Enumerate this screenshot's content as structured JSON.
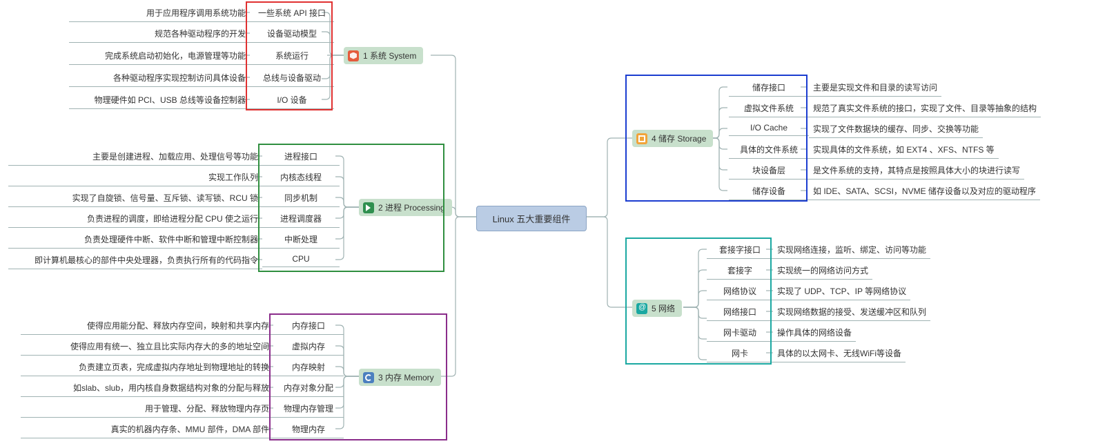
{
  "root": {
    "title": "Linux 五大重要组件"
  },
  "sections": {
    "system": {
      "label": "1 系统 System",
      "icon": "sys"
    },
    "process": {
      "label": "2 进程 Processing",
      "icon": "proc"
    },
    "memory": {
      "label": "3 内存 Memory",
      "icon": "mem"
    },
    "storage": {
      "label": "4 储存 Storage",
      "icon": "stor"
    },
    "network": {
      "label": "5 网络",
      "icon": "net"
    }
  },
  "frame_colors": {
    "system": "#e03030",
    "process": "#2f8f3f",
    "memory": "#8a2c8a",
    "storage": "#1a3cd0",
    "network": "#1aa8a1"
  },
  "system_items": [
    {
      "label": "一些系统 API 接口",
      "desc": "用于应用程序调用系统功能"
    },
    {
      "label": "设备驱动模型",
      "desc": "规范各种驱动程序的开发"
    },
    {
      "label": "系统运行",
      "desc": "完成系统启动初始化，电源管理等功能"
    },
    {
      "label": "总线与设备驱动",
      "desc": "各种驱动程序实现控制访问具体设备"
    },
    {
      "label": "I/O 设备",
      "desc": "物理硬件如 PCI、USB 总线等设备控制器"
    }
  ],
  "process_items": [
    {
      "label": "进程接口",
      "desc": "主要是创建进程、加载应用、处理信号等功能"
    },
    {
      "label": "内核态线程",
      "desc": "实现工作队列"
    },
    {
      "label": "同步机制",
      "desc": "实现了自旋锁、信号量、互斥锁、读写锁、RCU 锁"
    },
    {
      "label": "进程调度器",
      "desc": "负责进程的调度，即给进程分配 CPU 使之运行"
    },
    {
      "label": "中断处理",
      "desc": "负责处理硬件中断、软件中断和管理中断控制器"
    },
    {
      "label": "CPU",
      "desc": "即计算机最核心的部件中央处理器，负责执行所有的代码指令"
    }
  ],
  "memory_items": [
    {
      "label": "内存接口",
      "desc": "使得应用能分配、释放内存空间，映射和共享内存"
    },
    {
      "label": "虚拟内存",
      "desc": "使得应用有统一、独立且比实际内存大的多的地址空间"
    },
    {
      "label": "内存映射",
      "desc": "负责建立页表，完成虚拟内存地址到物理地址的转换"
    },
    {
      "label": "内存对象分配",
      "desc": "如slab、slub，用内核自身数据结构对象的分配与释放"
    },
    {
      "label": "物理内存管理",
      "desc": "用于管理、分配、释放物理内存页"
    },
    {
      "label": "物理内存",
      "desc": "真实的机器内存条、MMU 部件，DMA 部件"
    }
  ],
  "storage_items": [
    {
      "label": "储存接口",
      "desc": "主要是实现文件和目录的读写访问"
    },
    {
      "label": "虚拟文件系统",
      "desc": "规范了真实文件系统的接口，实现了文件、目录等抽象的结构"
    },
    {
      "label": "I/O Cache",
      "desc": "实现了文件数据块的缓存、同步、交换等功能"
    },
    {
      "label": "具体的文件系统",
      "desc": "实现具体的文件系统，如 EXT4 、XFS、NTFS 等"
    },
    {
      "label": "块设备层",
      "desc": "是文件系统的支持，其特点是按照具体大小的块进行读写"
    },
    {
      "label": "储存设备",
      "desc": "如 IDE、SATA、SCSI，NVME 储存设备以及对应的驱动程序"
    }
  ],
  "network_items": [
    {
      "label": "套接字接口",
      "desc": "实现网络连接，监听、绑定、访问等功能"
    },
    {
      "label": "套接字",
      "desc": "实现统一的网络访问方式"
    },
    {
      "label": "网络协议",
      "desc": "实现了 UDP、TCP、IP 等网络协议"
    },
    {
      "label": "网络接口",
      "desc": "实现网络数据的接受、发送缓冲区和队列"
    },
    {
      "label": "网卡驱动",
      "desc": "操作具体的网络设备"
    },
    {
      "label": "网卡",
      "desc": "具体的以太网卡、无线WiFi等设备"
    }
  ]
}
